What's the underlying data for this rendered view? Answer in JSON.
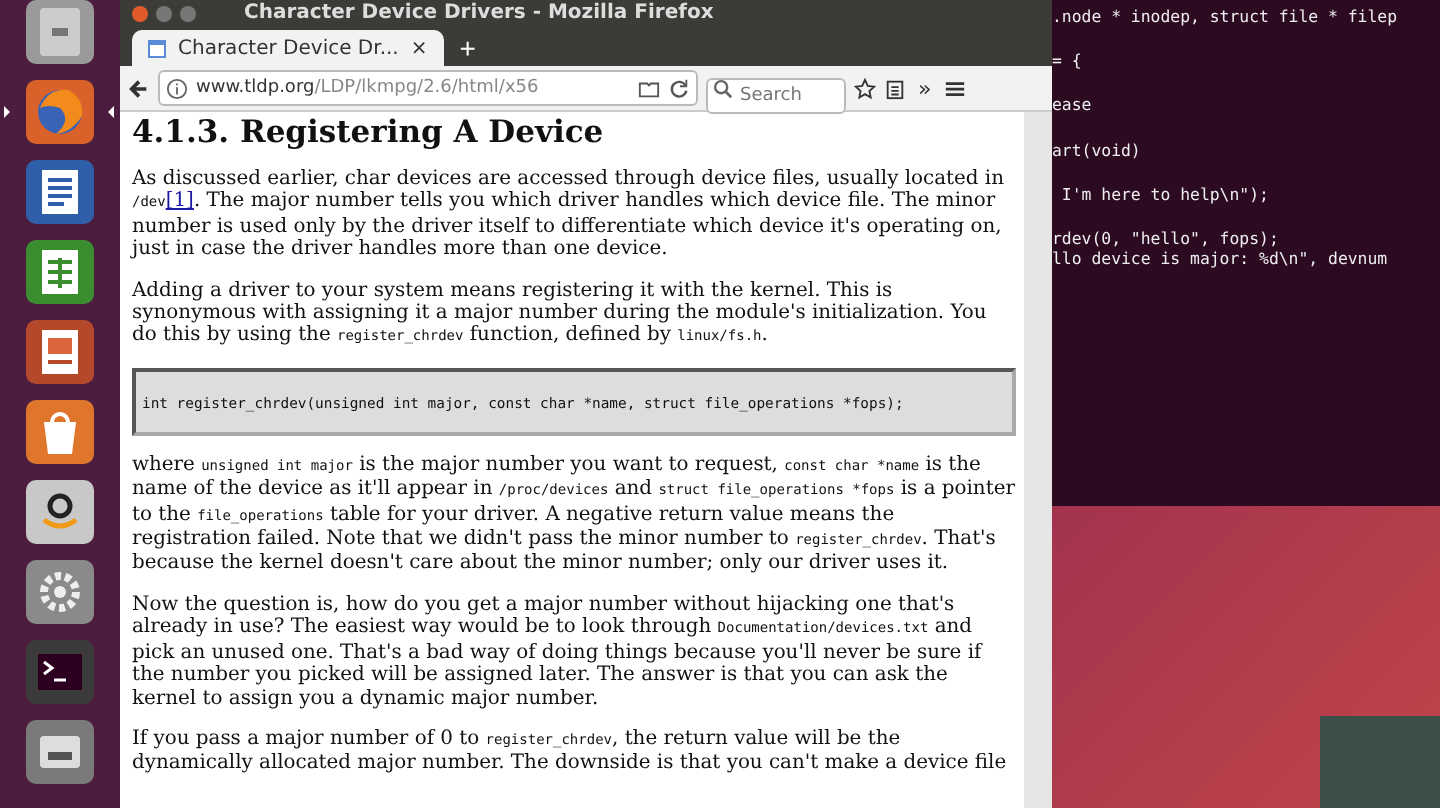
{
  "launcher": {
    "items": [
      {
        "kind": "files",
        "active": false
      },
      {
        "kind": "browser",
        "active": true
      },
      {
        "kind": "writer",
        "active": false
      },
      {
        "kind": "calc",
        "active": false
      },
      {
        "kind": "impress",
        "active": false
      },
      {
        "kind": "store",
        "active": false
      },
      {
        "kind": "amazon",
        "active": false
      },
      {
        "kind": "settings",
        "active": false
      },
      {
        "kind": "terminal",
        "active": false
      },
      {
        "kind": "drive",
        "active": false
      }
    ]
  },
  "browser": {
    "window_title": "Character Device Drivers - Mozilla Firefox",
    "tab": {
      "label": "Character Device Dr...",
      "close": "×"
    },
    "new_tab": "+",
    "url": {
      "host": "www.tldp.org",
      "path": "/LDP/lkmpg/2.6/html/x56"
    },
    "search": {
      "placeholder": "Search"
    },
    "overflow": "»",
    "page": {
      "heading": "4.1.3. Registering A Device",
      "blocks": [
        {
          "kind": "paragraph",
          "parts": [
            {
              "kind": "text",
              "text": "As discussed earlier, char devices are accessed through device files, usually located in "
            },
            {
              "kind": "code",
              "text": "/dev"
            },
            {
              "kind": "link",
              "text": "[1]"
            },
            {
              "kind": "text",
              "text": ". The major number tells you which driver handles which device file. The minor number is used only by the driver itself to differentiate which device it's operating on, just in case the driver handles more than one device."
            }
          ]
        },
        {
          "kind": "paragraph",
          "parts": [
            {
              "kind": "text",
              "text": "Adding a driver to your system means registering it with the kernel. This is synonymous with assigning it a major number during the module's initialization. You do this by using the "
            },
            {
              "kind": "code",
              "text": "register_chrdev"
            },
            {
              "kind": "text",
              "text": " function, defined by "
            },
            {
              "kind": "code",
              "text": "linux/fs.h"
            },
            {
              "kind": "text",
              "text": "."
            }
          ]
        },
        {
          "kind": "code_block",
          "text": "int register_chrdev(unsigned int major, const char *name, struct file_operations *fops);"
        },
        {
          "kind": "paragraph",
          "parts": [
            {
              "kind": "text",
              "text": "where "
            },
            {
              "kind": "code",
              "text": "unsigned int major"
            },
            {
              "kind": "text",
              "text": " is the major number you want to request, "
            },
            {
              "kind": "code",
              "text": "const char *name"
            },
            {
              "kind": "text",
              "text": " is the name of the device as it'll appear in "
            },
            {
              "kind": "code",
              "text": "/proc/devices"
            },
            {
              "kind": "text",
              "text": " and "
            },
            {
              "kind": "code",
              "text": "struct file_operations *fops"
            },
            {
              "kind": "text",
              "text": " is a pointer to the "
            },
            {
              "kind": "code",
              "text": "file_operations"
            },
            {
              "kind": "text",
              "text": " table for your driver. A negative return value means the registration failed. Note that we didn't pass the minor number to "
            },
            {
              "kind": "code",
              "text": "register_chrdev"
            },
            {
              "kind": "text",
              "text": ". That's because the kernel doesn't care about the minor number; only our driver uses it."
            }
          ]
        },
        {
          "kind": "paragraph",
          "parts": [
            {
              "kind": "text",
              "text": "Now the question is, how do you get a major number without hijacking one that's already in use? The easiest way would be to look through "
            },
            {
              "kind": "code",
              "text": "Documentation/devices.txt"
            },
            {
              "kind": "text",
              "text": " and pick an unused one. That's a bad way of doing things because you'll never be sure if the number you picked will be assigned later. The answer is that you can ask the kernel to assign you a dynamic major number."
            }
          ]
        },
        {
          "kind": "paragraph",
          "parts": [
            {
              "kind": "text",
              "text": "If you pass a major number of 0 to "
            },
            {
              "kind": "code",
              "text": "register_chrdev"
            },
            {
              "kind": "text",
              "text": ", the return value will be the dynamically allocated major number. The downside is that you can't make a device file"
            }
          ]
        }
      ]
    }
  },
  "terminal": {
    "groups": [
      {
        "lines": [
          ".node * inodep, struct file * filep"
        ]
      },
      {
        "lines": [
          "= {"
        ]
      },
      {
        "lines": [
          "ease"
        ]
      },
      {
        "lines": [
          "art(void)"
        ]
      },
      {
        "lines": [
          " I'm here to help\\n\");"
        ]
      },
      {
        "lines": [
          "rdev(0, \"hello\", fops);",
          "llo device is major: %d\\n\", devnum"
        ]
      }
    ]
  }
}
